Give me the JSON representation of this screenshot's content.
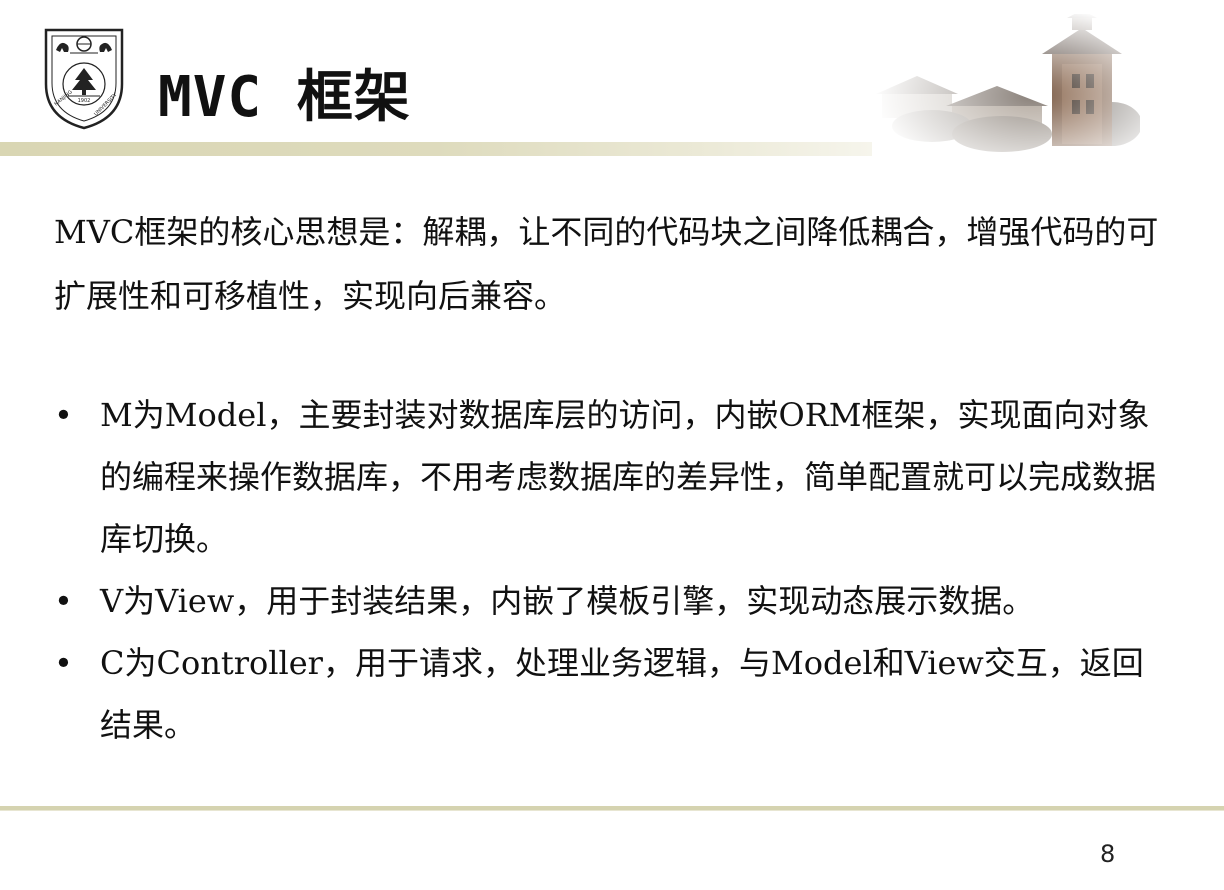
{
  "slide": {
    "title": "MVC 框架",
    "intro": "MVC框架的核心思想是：解耦，让不同的代码块之间降低耦合，增强代码的可扩展性和可移植性，实现向后兼容。",
    "bullet_symbol": "•",
    "bullets": [
      "M为Model，主要封装对数据库层的访问，内嵌ORM框架，实现面向对象的编程来操作数据库，不用考虑数据库的差异性，简单配置就可以完成数据库切换。",
      "V为View，用于封装结果，内嵌了模板引擎，实现动态展示数据。",
      "C为Controller，用于请求，处理业务逻辑，与Model和View交互，返回结果。"
    ],
    "page_number": "8"
  },
  "logo": {
    "year": "1902",
    "ring_text": "NANJING UNIVERSITY",
    "icon": "university-emblem-icon"
  },
  "decoration": {
    "icon": "campus-tower-image"
  },
  "colors": {
    "rule": "#d5d3b0",
    "text": "#111111"
  }
}
